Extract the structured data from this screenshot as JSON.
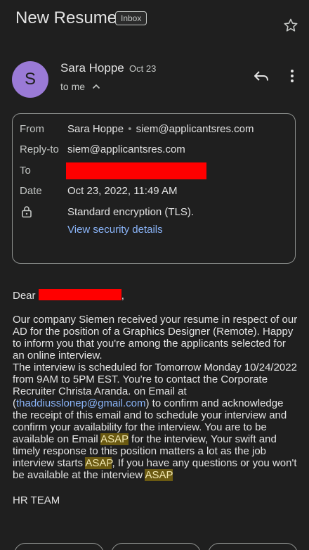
{
  "email": {
    "subject": "New Resume",
    "label": "Inbox",
    "sender": {
      "initial": "S",
      "name": "Sara Hoppe",
      "date": "Oct 23",
      "to_line": "to me"
    },
    "details": {
      "from_label": "From",
      "from_name": "Sara Hoppe",
      "from_email": "siem@applicantsres.com",
      "reply_to_label": "Reply-to",
      "reply_to_value": "siem@applicantsres.com",
      "to_label": "To",
      "date_label": "Date",
      "date_value": "Oct 23, 2022, 11:49 AM",
      "encryption": "Standard encryption (TLS).",
      "security_link": "View security details"
    },
    "body": {
      "greeting_start": "Dear",
      "greeting_end": ",",
      "p1": "Our company Siemen received your resume in respect of our AD for the position of a Graphics Designer (Remote). Happy to inform you that you're among the applicants selected for an online interview.",
      "p2_a": "The interview is scheduled for Tomorrow Monday 10/24/2022 from 9AM to 5PM EST. You're to contact the Corporate Recruiter Christa Aranda. on Email at (",
      "p2_link": "thaddiusslonep@gmail.com",
      "p2_b": ") to confirm and acknowledge the receipt of this email and to schedule your interview and confirm your availability for the interview. You are to be available on Email ",
      "asap": "ASAP",
      "p2_c": " for the interview, Your swift and timely response to this position matters a lot as the job interview starts ",
      "p2_d": ", If you have any questions or you won't be available at the interview ",
      "signature": "HR TEAM"
    }
  },
  "icons": {
    "star": "star-icon",
    "reply": "reply-icon",
    "more": "more-vert-icon",
    "lock": "lock-icon",
    "chevron": "chevron-up-icon"
  },
  "colors": {
    "avatar": "#9a7ad6",
    "link": "#8ab4f8",
    "highlight": "#6b5a12",
    "redaction": "#ff0000"
  }
}
